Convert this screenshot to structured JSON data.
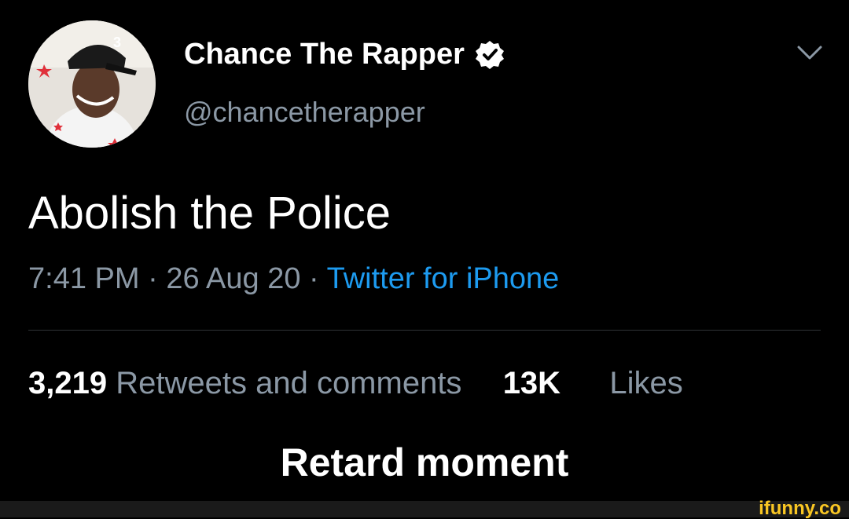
{
  "tweet": {
    "display_name": "Chance The Rapper",
    "handle": "@chancetherapper",
    "text": "Abolish the Police",
    "time": "7:41 PM",
    "separator": "·",
    "date": "26 Aug 20",
    "source": "Twitter for iPhone",
    "retweets_count": "3,219",
    "retweets_label": "Retweets and comments",
    "likes_count": "13K",
    "likes_label": "Likes"
  },
  "caption": "Retard moment",
  "watermark": "ifunny.co",
  "colors": {
    "background": "#000000",
    "link_blue": "#1d9bf0",
    "muted_text": "#8b98a5",
    "watermark": "#f9c623"
  },
  "icons": {
    "verified": "verified-badge-icon",
    "more": "chevron-down-icon"
  }
}
